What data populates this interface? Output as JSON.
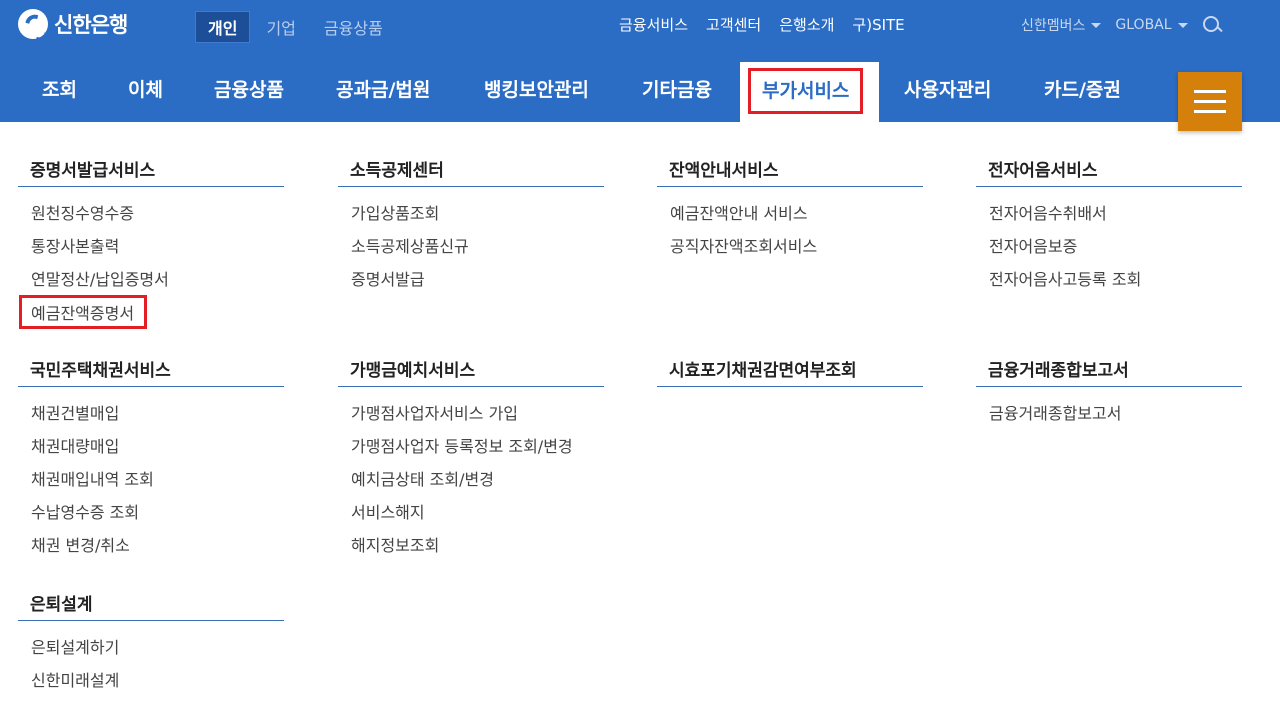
{
  "brand": {
    "name": "신한은행"
  },
  "segments": [
    {
      "label": "개인",
      "active": true
    },
    {
      "label": "기업",
      "active": false
    },
    {
      "label": "금융상품",
      "active": false
    }
  ],
  "utilities": [
    "금융서비스",
    "고객센터",
    "은행소개",
    "구)SITE"
  ],
  "right_utils": {
    "members": "신한멤버스",
    "global": "GLOBAL"
  },
  "gnb": [
    {
      "label": "조회"
    },
    {
      "label": "이체"
    },
    {
      "label": "금융상품"
    },
    {
      "label": "공과금/법원"
    },
    {
      "label": "뱅킹보안관리"
    },
    {
      "label": "기타금융"
    },
    {
      "label": "부가서비스",
      "active": true
    },
    {
      "label": "사용자관리"
    },
    {
      "label": "카드/증권"
    }
  ],
  "menu": {
    "cert": {
      "title": "증명서발급서비스",
      "items": [
        "원천징수영수증",
        "통장사본출력",
        "연말정산/납입증명서",
        "예금잔액증명서"
      ]
    },
    "tax": {
      "title": "소득공제센터",
      "items": [
        "가입상품조회",
        "소득공제상품신규",
        "증명서발급"
      ]
    },
    "balance": {
      "title": "잔액안내서비스",
      "items": [
        "예금잔액안내 서비스",
        "공직자잔액조회서비스"
      ]
    },
    "bill": {
      "title": "전자어음서비스",
      "items": [
        "전자어음수취배서",
        "전자어음보증",
        "전자어음사고등록 조회"
      ]
    },
    "bond": {
      "title": "국민주택채권서비스",
      "items": [
        "채권건별매입",
        "채권대량매입",
        "채권매입내역 조회",
        "수납영수증 조회",
        "채권 변경/취소"
      ]
    },
    "merchant": {
      "title": "가맹금예치서비스",
      "items": [
        "가맹점사업자서비스 가입",
        "가맹점사업자 등록정보 조회/변경",
        "예치금상태 조회/변경",
        "서비스해지",
        "해지정보조회"
      ]
    },
    "prescription": {
      "title": "시효포기채권감면여부조회",
      "items": []
    },
    "report": {
      "title": "금융거래종합보고서",
      "items": [
        "금융거래종합보고서"
      ]
    },
    "retire": {
      "title": "은퇴설계",
      "items": [
        "은퇴설계하기",
        "신한미래설계"
      ]
    }
  },
  "colors": {
    "header_blue": "#2b6cc4",
    "highlight_red": "#e31e24",
    "menu_button": "#d4800b"
  }
}
